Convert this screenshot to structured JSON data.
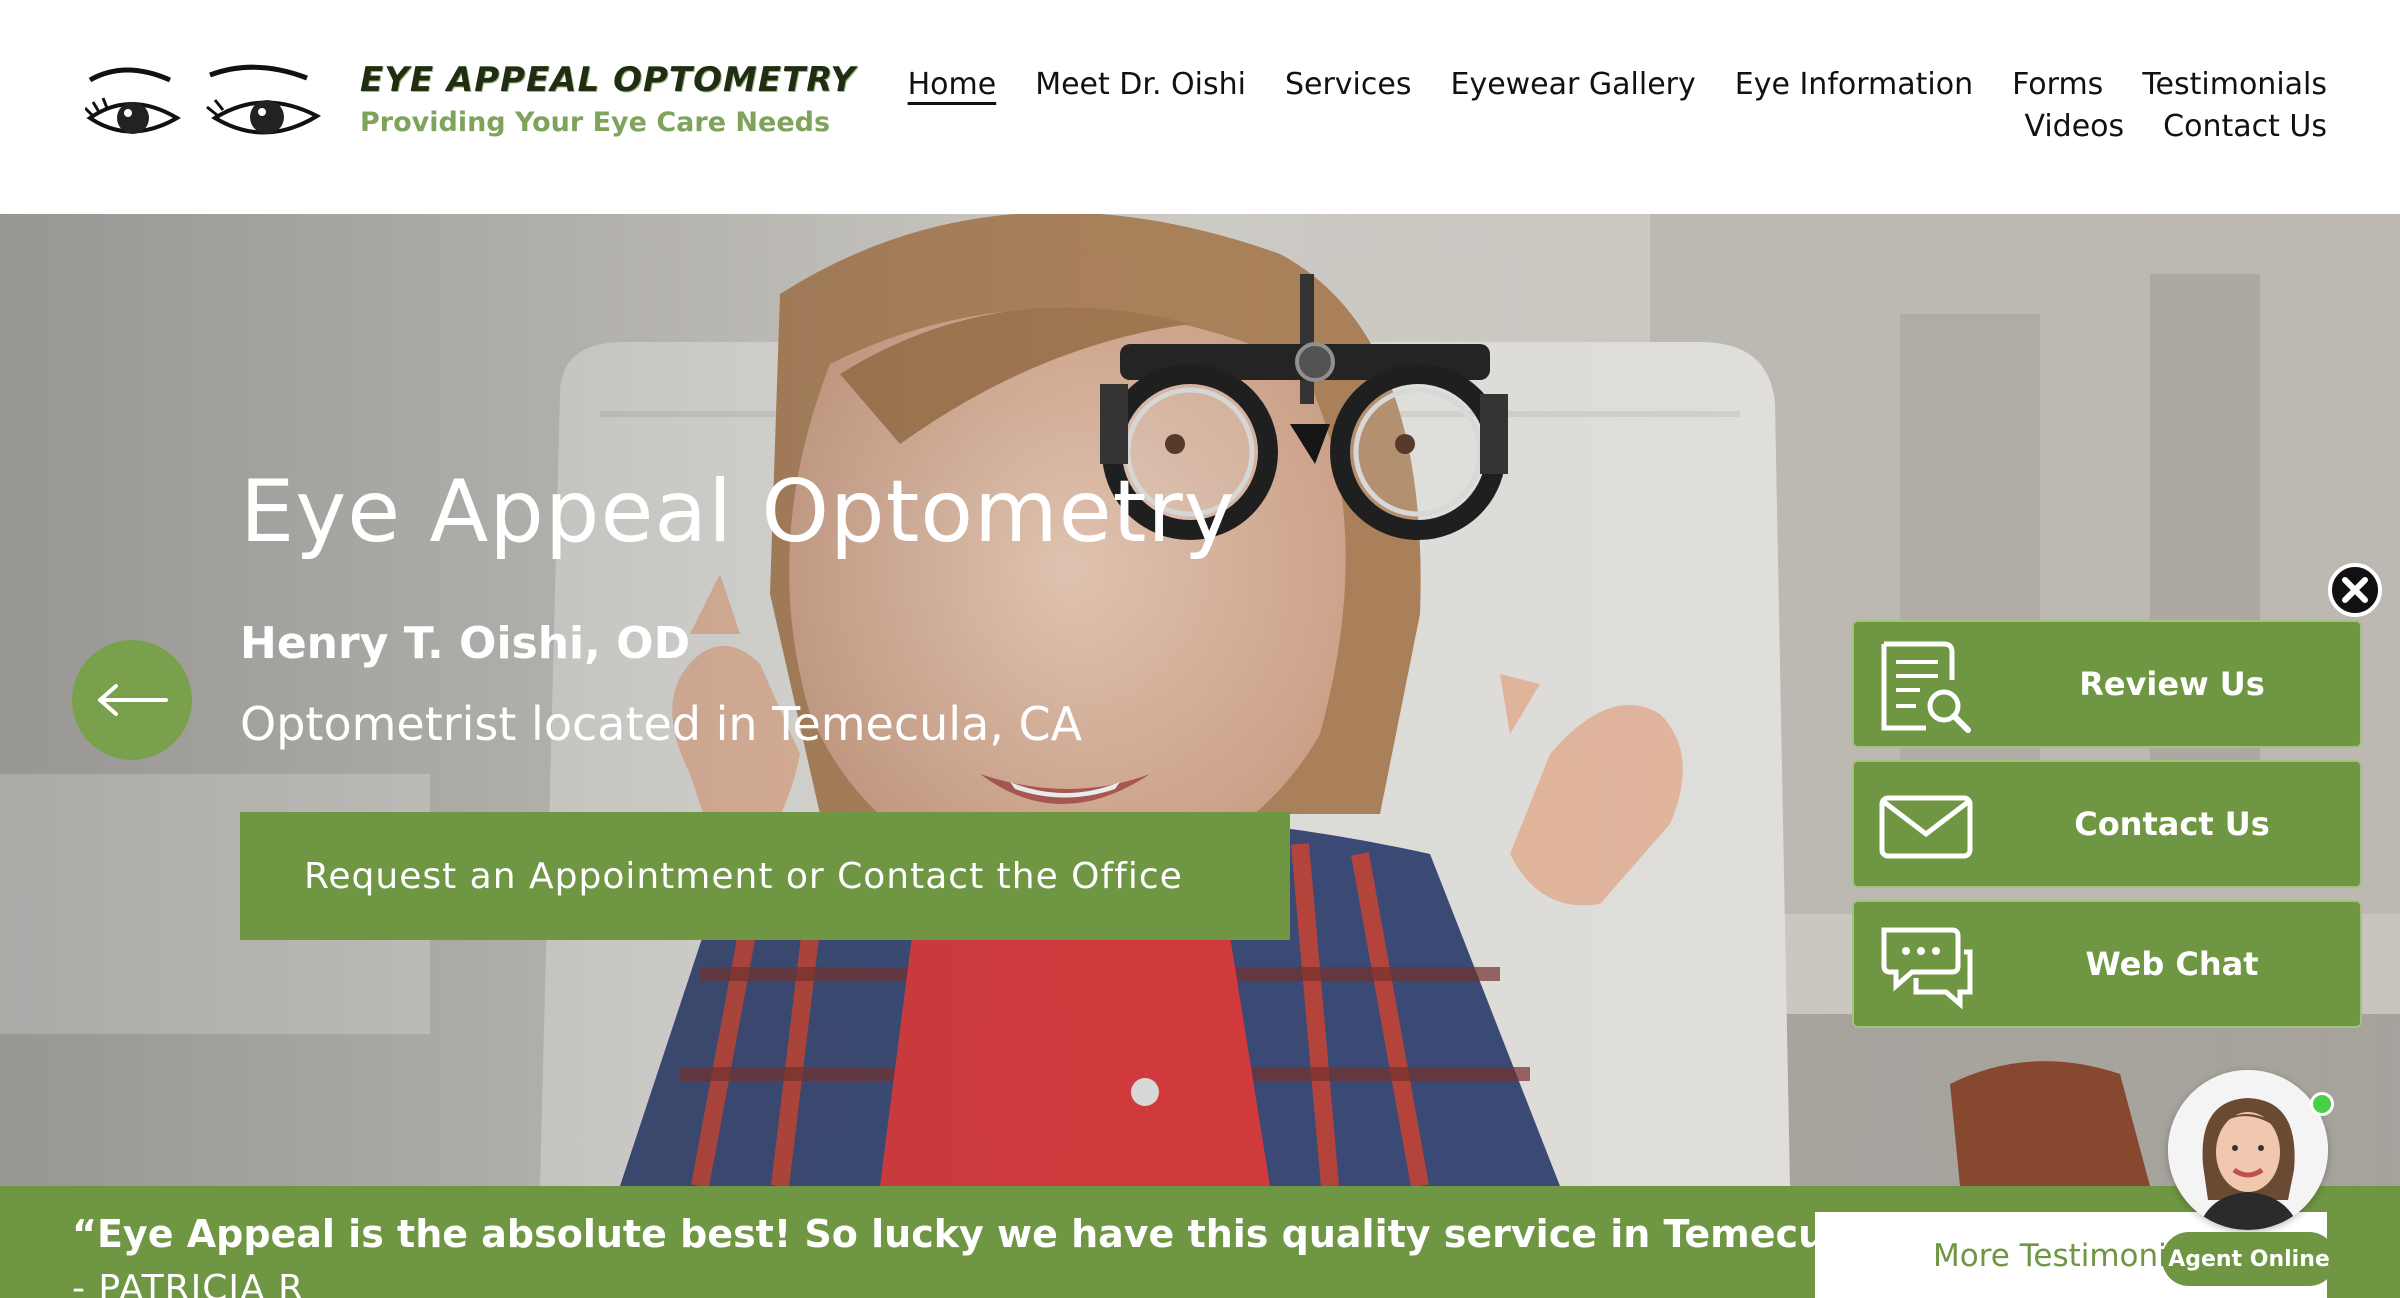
{
  "header": {
    "logo_title": "EYE APPEAL OPTOMETRY",
    "logo_tagline": "Providing Your Eye Care Needs",
    "nav_row1": [
      "Home",
      "Meet Dr. Oishi",
      "Services",
      "Eyewear Gallery",
      "Eye Information",
      "Forms",
      "Testimonials"
    ],
    "nav_row2": [
      "Videos",
      "Contact Us"
    ],
    "active_nav": "Home"
  },
  "hero": {
    "title": "Eye Appeal Optometry",
    "doctor_name": "Henry T. Oishi, OD",
    "subtitle": "Optometrist located in Temecula, CA",
    "cta_label": "Request an Appointment or Contact the Office"
  },
  "side_widget": {
    "buttons": [
      {
        "label": "Review Us",
        "icon": "review-document-icon"
      },
      {
        "label": "Contact Us",
        "icon": "envelope-icon"
      },
      {
        "label": "Web Chat",
        "icon": "chat-bubbles-icon"
      }
    ],
    "agent_status": "Agent Online"
  },
  "testimonial": {
    "quote": "“Eye Appeal is the absolute best! So lucky we have this quality service in Temecula!”",
    "author": "- PATRICIA R",
    "more_label": "More Testimonials"
  },
  "colors": {
    "brand_green": "#6f9642",
    "logo_green": "#7fa35a",
    "online_dot": "#49d046"
  }
}
